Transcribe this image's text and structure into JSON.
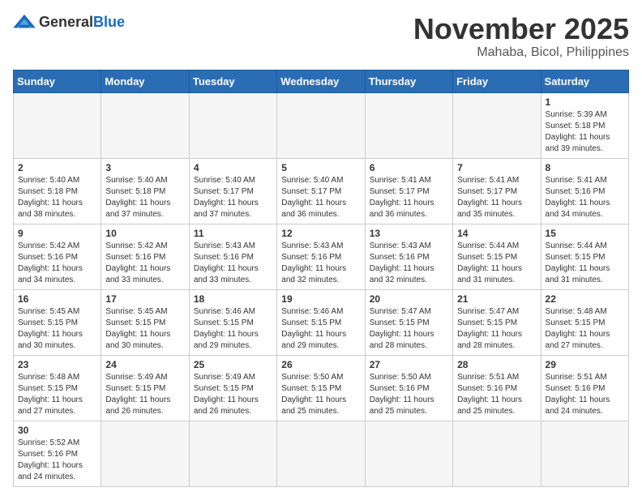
{
  "logo": {
    "general": "General",
    "blue": "Blue"
  },
  "title": "November 2025",
  "location": "Mahaba, Bicol, Philippines",
  "days_of_week": [
    "Sunday",
    "Monday",
    "Tuesday",
    "Wednesday",
    "Thursday",
    "Friday",
    "Saturday"
  ],
  "weeks": [
    [
      {
        "day": "",
        "info": ""
      },
      {
        "day": "",
        "info": ""
      },
      {
        "day": "",
        "info": ""
      },
      {
        "day": "",
        "info": ""
      },
      {
        "day": "",
        "info": ""
      },
      {
        "day": "",
        "info": ""
      },
      {
        "day": "1",
        "info": "Sunrise: 5:39 AM\nSunset: 5:18 PM\nDaylight: 11 hours\nand 39 minutes."
      }
    ],
    [
      {
        "day": "2",
        "info": "Sunrise: 5:40 AM\nSunset: 5:18 PM\nDaylight: 11 hours\nand 38 minutes."
      },
      {
        "day": "3",
        "info": "Sunrise: 5:40 AM\nSunset: 5:18 PM\nDaylight: 11 hours\nand 37 minutes."
      },
      {
        "day": "4",
        "info": "Sunrise: 5:40 AM\nSunset: 5:17 PM\nDaylight: 11 hours\nand 37 minutes."
      },
      {
        "day": "5",
        "info": "Sunrise: 5:40 AM\nSunset: 5:17 PM\nDaylight: 11 hours\nand 36 minutes."
      },
      {
        "day": "6",
        "info": "Sunrise: 5:41 AM\nSunset: 5:17 PM\nDaylight: 11 hours\nand 36 minutes."
      },
      {
        "day": "7",
        "info": "Sunrise: 5:41 AM\nSunset: 5:17 PM\nDaylight: 11 hours\nand 35 minutes."
      },
      {
        "day": "8",
        "info": "Sunrise: 5:41 AM\nSunset: 5:16 PM\nDaylight: 11 hours\nand 34 minutes."
      }
    ],
    [
      {
        "day": "9",
        "info": "Sunrise: 5:42 AM\nSunset: 5:16 PM\nDaylight: 11 hours\nand 34 minutes."
      },
      {
        "day": "10",
        "info": "Sunrise: 5:42 AM\nSunset: 5:16 PM\nDaylight: 11 hours\nand 33 minutes."
      },
      {
        "day": "11",
        "info": "Sunrise: 5:43 AM\nSunset: 5:16 PM\nDaylight: 11 hours\nand 33 minutes."
      },
      {
        "day": "12",
        "info": "Sunrise: 5:43 AM\nSunset: 5:16 PM\nDaylight: 11 hours\nand 32 minutes."
      },
      {
        "day": "13",
        "info": "Sunrise: 5:43 AM\nSunset: 5:16 PM\nDaylight: 11 hours\nand 32 minutes."
      },
      {
        "day": "14",
        "info": "Sunrise: 5:44 AM\nSunset: 5:15 PM\nDaylight: 11 hours\nand 31 minutes."
      },
      {
        "day": "15",
        "info": "Sunrise: 5:44 AM\nSunset: 5:15 PM\nDaylight: 11 hours\nand 31 minutes."
      }
    ],
    [
      {
        "day": "16",
        "info": "Sunrise: 5:45 AM\nSunset: 5:15 PM\nDaylight: 11 hours\nand 30 minutes."
      },
      {
        "day": "17",
        "info": "Sunrise: 5:45 AM\nSunset: 5:15 PM\nDaylight: 11 hours\nand 30 minutes."
      },
      {
        "day": "18",
        "info": "Sunrise: 5:46 AM\nSunset: 5:15 PM\nDaylight: 11 hours\nand 29 minutes."
      },
      {
        "day": "19",
        "info": "Sunrise: 5:46 AM\nSunset: 5:15 PM\nDaylight: 11 hours\nand 29 minutes."
      },
      {
        "day": "20",
        "info": "Sunrise: 5:47 AM\nSunset: 5:15 PM\nDaylight: 11 hours\nand 28 minutes."
      },
      {
        "day": "21",
        "info": "Sunrise: 5:47 AM\nSunset: 5:15 PM\nDaylight: 11 hours\nand 28 minutes."
      },
      {
        "day": "22",
        "info": "Sunrise: 5:48 AM\nSunset: 5:15 PM\nDaylight: 11 hours\nand 27 minutes."
      }
    ],
    [
      {
        "day": "23",
        "info": "Sunrise: 5:48 AM\nSunset: 5:15 PM\nDaylight: 11 hours\nand 27 minutes."
      },
      {
        "day": "24",
        "info": "Sunrise: 5:49 AM\nSunset: 5:15 PM\nDaylight: 11 hours\nand 26 minutes."
      },
      {
        "day": "25",
        "info": "Sunrise: 5:49 AM\nSunset: 5:15 PM\nDaylight: 11 hours\nand 26 minutes."
      },
      {
        "day": "26",
        "info": "Sunrise: 5:50 AM\nSunset: 5:15 PM\nDaylight: 11 hours\nand 25 minutes."
      },
      {
        "day": "27",
        "info": "Sunrise: 5:50 AM\nSunset: 5:16 PM\nDaylight: 11 hours\nand 25 minutes."
      },
      {
        "day": "28",
        "info": "Sunrise: 5:51 AM\nSunset: 5:16 PM\nDaylight: 11 hours\nand 25 minutes."
      },
      {
        "day": "29",
        "info": "Sunrise: 5:51 AM\nSunset: 5:16 PM\nDaylight: 11 hours\nand 24 minutes."
      }
    ],
    [
      {
        "day": "30",
        "info": "Sunrise: 5:52 AM\nSunset: 5:16 PM\nDaylight: 11 hours\nand 24 minutes."
      },
      {
        "day": "",
        "info": ""
      },
      {
        "day": "",
        "info": ""
      },
      {
        "day": "",
        "info": ""
      },
      {
        "day": "",
        "info": ""
      },
      {
        "day": "",
        "info": ""
      },
      {
        "day": "",
        "info": ""
      }
    ]
  ]
}
